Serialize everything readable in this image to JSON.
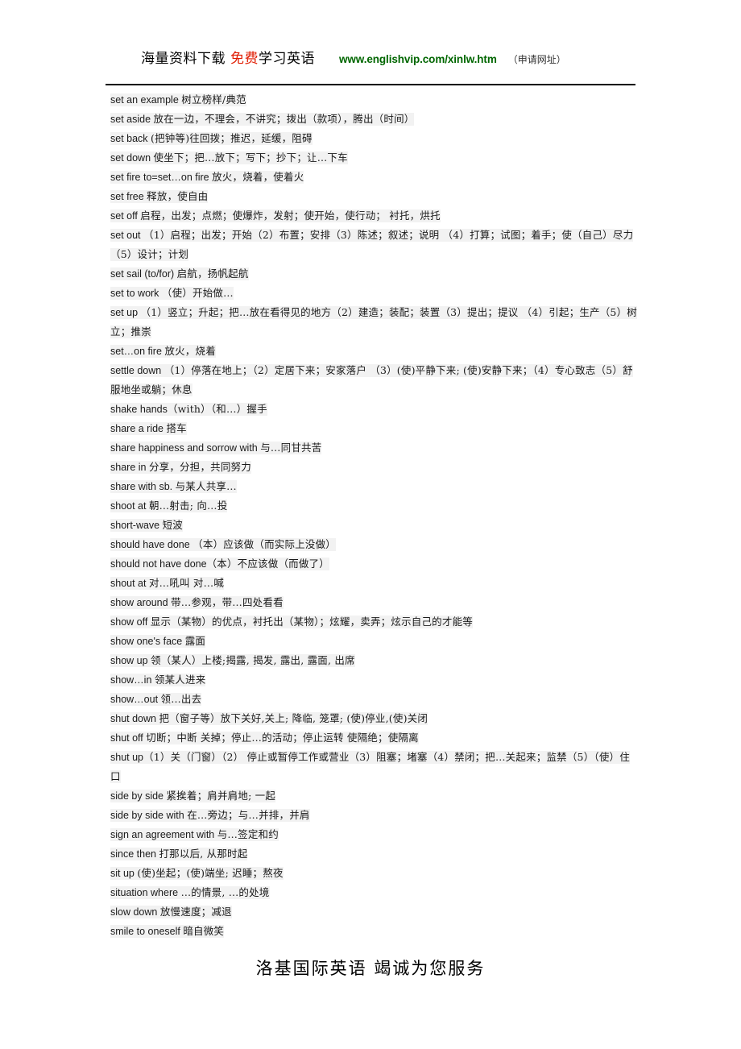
{
  "header": {
    "cn_lead": "海量资料下载",
    "cn_red": "免费",
    "cn_after_red": "学习英语",
    "url": "www.englishvip.com/xinlw.htm",
    "note": "（申请网址）",
    "colors": {
      "red": "#e01b00",
      "green": "#006600",
      "rule": "#000000",
      "highlight": "#f2f2f2"
    }
  },
  "entries": [
    {
      "en": "set an example ",
      "cn": "树立榜样/典范"
    },
    {
      "en": "set aside ",
      "cn": "放在一边，不理会，不讲究；拨出（款项），腾出（时间）"
    },
    {
      "en": "set back ",
      "cn": "(把钟等)往回拨；推迟，延缓，阻碍"
    },
    {
      "en": "set down  ",
      "cn": "使坐下；把…放下；写下；抄下；让…下车"
    },
    {
      "en": "set fire to=set…on fire ",
      "cn": "放火，烧着，使着火"
    },
    {
      "en": "set free  ",
      "cn": "释放，使自由"
    },
    {
      "en": "set off  ",
      "cn": "启程，出发；点燃；使爆炸，发射；使开始，使行动； 衬托，烘托"
    },
    {
      "en": "set out ",
      "cn": "（1）启程；出发；开始（2）布置；安排（3）陈述；叙述；说明 （4）打算；试图；着手；使（自己）尽力 （5）设计；计划"
    },
    {
      "en": "set sail (to/for)  ",
      "cn": "启航，扬帆起航"
    },
    {
      "en": "set to work  ",
      "cn": "（使）开始做…"
    },
    {
      "en": "set up ",
      "cn": "（1）竖立；升起；把…放在看得见的地方（2）建造；装配；装置（3）提出；提议 （4）引起；生产（5）树立；推崇"
    },
    {
      "en": "set…on fire  ",
      "cn": "放火，烧着"
    },
    {
      "en": "settle down ",
      "cn": "（1）停落在地上；（2）定居下来；安家落户 （3）(使)平静下来; (使)安静下来；（4）专心致志（5）舒服地坐或躺；休息"
    },
    {
      "en": "shake hands",
      "cn": "（with）（和…）握手"
    },
    {
      "en": "share a ride  ",
      "cn": "搭车"
    },
    {
      "en": "share happiness and sorrow with  ",
      "cn": "与…同甘共苦"
    },
    {
      "en": "share in ",
      "cn": "分享，分担，共同努力"
    },
    {
      "en": "share with sb.  ",
      "cn": "与某人共享…"
    },
    {
      "en": "shoot at  ",
      "cn": "朝…射击; 向…投"
    },
    {
      "en": "short-wave  ",
      "cn": "短波"
    },
    {
      "en": "should have done  ",
      "cn": "（本）应该做（而实际上没做）"
    },
    {
      "en": "should not have done",
      "cn": "（本）不应该做（而做了）"
    },
    {
      "en": "shout at  ",
      "cn": "对…吼叫 对…喊"
    },
    {
      "en": "show around ",
      "cn": "带…参观，带…四处看看"
    },
    {
      "en": "show off  ",
      "cn": "显示（某物）的优点，衬托出（某物）；炫耀，卖弄；炫示自己的才能等"
    },
    {
      "en": "show one's face ",
      "cn": "露面"
    },
    {
      "en": "show up ",
      "cn": "领（某人）上楼;揭露, 揭发, 露出, 露面, 出席"
    },
    {
      "en": "show…in   ",
      "cn": "领某人进来"
    },
    {
      "en": "show…out ",
      "cn": "领…出去"
    },
    {
      "en": "shut down ",
      "cn": "把（窗子等）放下关好,关上; 降临, 笼罩; (使)停业,(使)关闭"
    },
    {
      "en": "shut off ",
      "cn": "切断；中断  关掉；停止…的活动；停止运转  使隔绝；使隔离"
    },
    {
      "en": "shut up",
      "cn": "（1）关（门窗）（2） 停止或暂停工作或营业（3）阻塞；堵塞（4）禁闭；把…关起来；监禁（5）（使）住口"
    },
    {
      "en": "side by side  ",
      "cn": "紧挨着；肩并肩地; 一起"
    },
    {
      "en": "side by side with ",
      "cn": "在…旁边；与…并排，并肩"
    },
    {
      "en": "sign an agreement with ",
      "cn": "与…签定和约"
    },
    {
      "en": "since then  ",
      "cn": "打那以后, 从那时起"
    },
    {
      "en": "sit up  ",
      "cn": "(使)坐起；(使)端坐; 迟睡；熬夜"
    },
    {
      "en": "situation where ",
      "cn": "…的情景, …的处境"
    },
    {
      "en": "slow down   ",
      "cn": "放慢速度；减退"
    },
    {
      "en": "smile to oneself ",
      "cn": "暗自微笑"
    }
  ],
  "footer": {
    "text": "洛基国际英语    竭诚为您服务"
  }
}
